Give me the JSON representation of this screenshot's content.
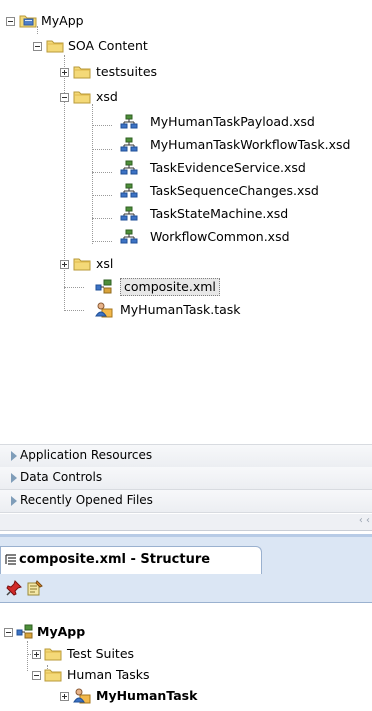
{
  "project_tree": {
    "root": "MyApp",
    "soa_content": "SOA Content",
    "testsuites": "testsuites",
    "xsd": "xsd",
    "xsd_files": [
      "MyHumanTaskPayload.xsd",
      "MyHumanTaskWorkflowTask.xsd",
      "TaskEvidenceService.xsd",
      "TaskSequenceChanges.xsd",
      "TaskStateMachine.xsd",
      "WorkflowCommon.xsd"
    ],
    "xsl": "xsl",
    "composite": "composite.xml",
    "task": "MyHumanTask.task"
  },
  "accordion": {
    "items": [
      "Application Resources",
      "Data Controls",
      "Recently Opened Files"
    ]
  },
  "structure_panel": {
    "tab_title": "composite.xml - Structure"
  },
  "structure_tree": {
    "root": "MyApp",
    "test_suites": "Test Suites",
    "human_tasks": "Human Tasks",
    "my_human_task": "MyHumanTask"
  },
  "colors": {
    "folder": "#f2d56b",
    "accent": "#7f9db9",
    "tab_bg": "#ffffff"
  }
}
